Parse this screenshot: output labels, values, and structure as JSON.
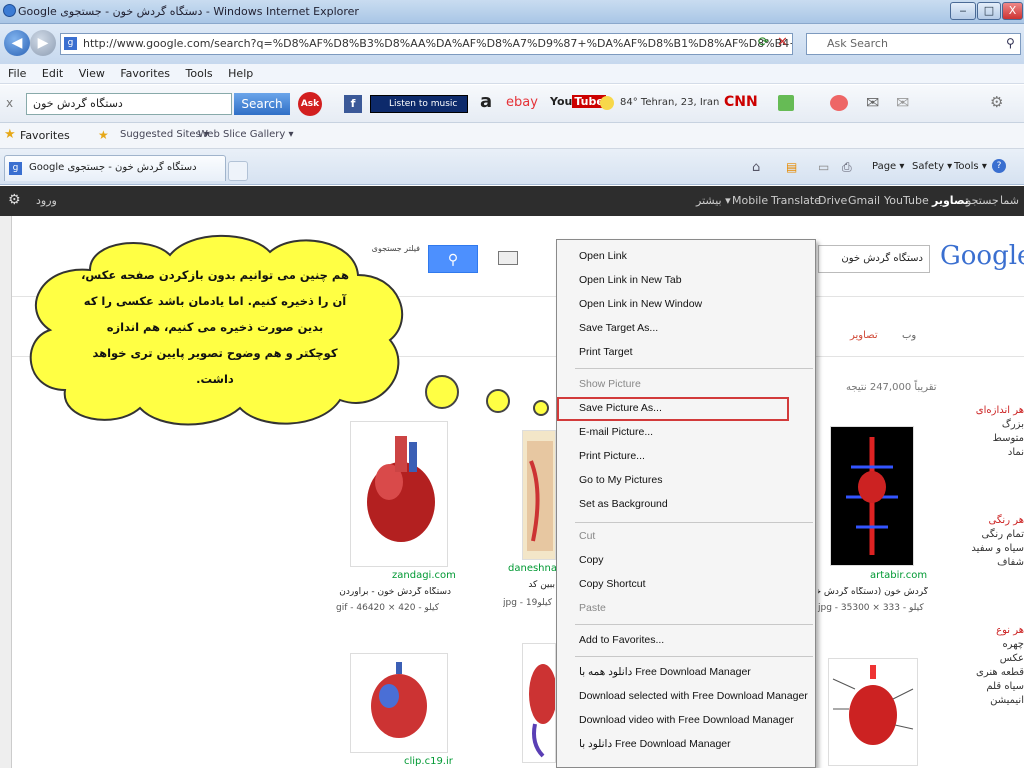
{
  "window": {
    "title": "Google دستگاه گردش خون - جستجوی - Windows Internet Explorer",
    "min": "‒",
    "max": "□",
    "close": "X"
  },
  "nav": {
    "url": "http://www.google.com/search?q=%D8%AF%D8%B3%D8%AA%DA%AF%D8%A7%D9%87+%DA%AF%D8%B1%D8%AF%D8%B4+%D8%AE%D9%88%D9%86&nl=",
    "ask_placeholder": "Ask Search"
  },
  "menu": {
    "items": [
      "File",
      "Edit",
      "View",
      "Favorites",
      "Tools",
      "Help"
    ]
  },
  "askbar": {
    "query": "دستگاه گردش خون",
    "search_label": "Search",
    "listen_label": "Listen to music",
    "weather": "84° Tehran, 23, Iran"
  },
  "favbar": {
    "favorites": "Favorites",
    "suggested": "Suggested Sites ▾",
    "webslice": "Web Slice Gallery ▾"
  },
  "tab": {
    "label": "Google دستگاه گردش خون - جستجوی",
    "page": "Page ▾",
    "safety": "Safety ▾",
    "tools": "Tools ▾"
  },
  "gbar": {
    "left_items": [
      "شما",
      "جستجو",
      "تصاویر",
      "YouTube",
      "Gmail",
      "Drive",
      "Translate",
      "Mobile",
      "بیشتر ▾"
    ],
    "signin": "ورود"
  },
  "search": {
    "query": "دستگاه گردش خون",
    "logo": "Google",
    "filter_note": "فیلتر جستجوی ایمن",
    "results_count": "تقریباً 247,000 نتیجه",
    "tab_web": "وب",
    "tab_images": "تصاویر"
  },
  "sidebar": {
    "size_title": "هر اندازه‌ای",
    "size_items": [
      "بزرگ",
      "متوسط",
      "نماد"
    ],
    "color_title": "هر رنگی",
    "color_items": [
      "تمام رنگی",
      "سیاه و سفید",
      "شفاف"
    ],
    "type_title": "هر نوع",
    "type_items": [
      "چهره",
      "عکس",
      "قطعه هنری",
      "سیاه قلم",
      "انیمیشن"
    ]
  },
  "results": [
    {
      "site": "zandagi.com",
      "caption": "دستگاه گردش خون - برآوردن",
      "size": "gif - 46کیلو - 420 × 420"
    },
    {
      "site": "daneshnam",
      "caption": "ببین کد",
      "size": "jpg - 19کیلو"
    },
    {
      "site": "artabir.com",
      "caption": "گردش خون (دستگاه گردش خون)",
      "size": "jpg - 35کیلو - 333 × 300"
    },
    {
      "site": "clip.c19.ir",
      "caption": "",
      "size": ""
    }
  ],
  "context_menu": {
    "items": [
      "Open Link",
      "Open Link in New Tab",
      "Open Link in New Window",
      "Save Target As...",
      "Print Target",
      "Show Picture",
      "Save Picture As...",
      "E-mail Picture...",
      "Print Picture...",
      "Go to My Pictures",
      "Set as Background",
      "Cut",
      "Copy",
      "Copy Shortcut",
      "Paste",
      "Add to Favorites...",
      "دانلود همه با Free Download Manager",
      "Download selected with Free Download Manager",
      "Download video with Free Download Manager",
      "دانلود با Free Download Manager"
    ],
    "highlighted": "Save Picture As..."
  },
  "annotation": {
    "lines": [
      "هم چنین می توانیم بدون بازکردن صفحه عکس،",
      "آن را ذخیره کنیم. اما یادمان باشد عکسی را که",
      "بدین صورت ذخیره                 می کنیم، هم اندازه",
      "کوچکتر و هم وضوح تصویر پایین تری خواهد",
      "داشت."
    ]
  },
  "colors": {
    "bubble": "#ffff44",
    "highlight": "#d23a3a",
    "gbar": "#2d2d2d",
    "google_blue": "#4d90fe"
  }
}
